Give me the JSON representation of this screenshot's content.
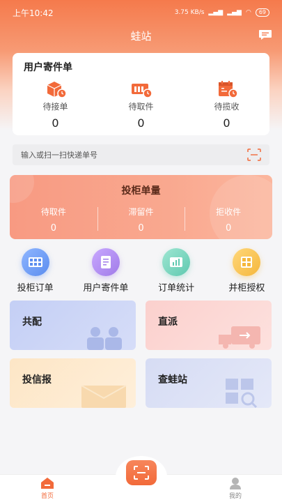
{
  "status_bar": {
    "time": "上午10:42",
    "net_speed": "3.75 KB/s",
    "signal1": "4G",
    "signal2": "4G",
    "battery": "69"
  },
  "header": {
    "title": "蛙站"
  },
  "user_orders": {
    "title": "用户寄件单",
    "stats": [
      {
        "label": "待接单",
        "value": "0",
        "icon": "package-clock-icon"
      },
      {
        "label": "待取件",
        "value": "0",
        "icon": "truck-clock-icon"
      },
      {
        "label": "待揽收",
        "value": "0",
        "icon": "calendar-clock-icon"
      }
    ]
  },
  "search": {
    "placeholder": "输入或扫一扫快递单号"
  },
  "cabinet": {
    "title": "投柜单量",
    "stats": [
      {
        "label": "待取件",
        "value": "0"
      },
      {
        "label": "滞留件",
        "value": "0"
      },
      {
        "label": "拒收件",
        "value": "0"
      }
    ]
  },
  "quick_actions": [
    {
      "label": "投柜订单",
      "icon": "cabinet-grid-icon",
      "color": "#5b8def"
    },
    {
      "label": "用户寄件单",
      "icon": "document-icon",
      "color": "#a07be8"
    },
    {
      "label": "订单统计",
      "icon": "chart-icon",
      "color": "#5fc9b0"
    },
    {
      "label": "并柜授权",
      "icon": "merge-cabinet-icon",
      "color": "#f5b73c"
    }
  ],
  "tiles": [
    {
      "label": "共配"
    },
    {
      "label": "直派"
    },
    {
      "label": "投信报"
    },
    {
      "label": "查蛙站"
    }
  ],
  "bottom_nav": {
    "home": "首页",
    "mine": "我的"
  },
  "colors": {
    "brand": "#f26a3a"
  }
}
